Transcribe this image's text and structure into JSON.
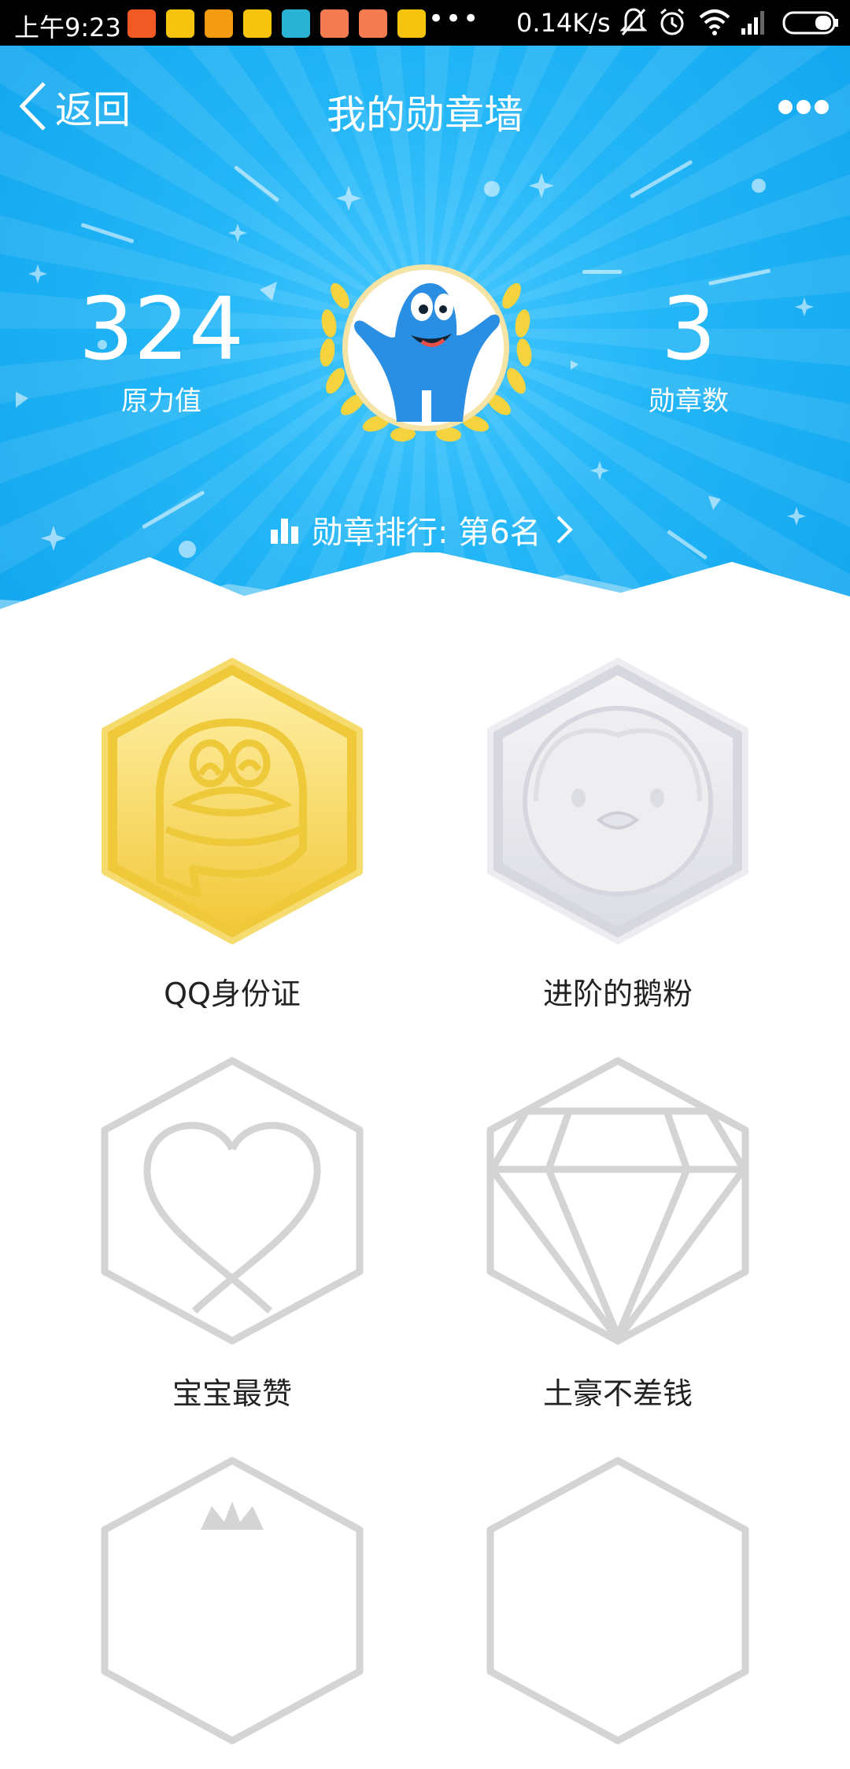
{
  "status_bar": {
    "time": "上午9:23",
    "more_indicator": "•••",
    "network_speed": "0.14K/s",
    "notification_icons": [
      "taobao-icon",
      "weibo-icon",
      "uc-icon",
      "weibo-icon",
      "clock-app-icon",
      "mi-icon",
      "mi-icon",
      "weibo-icon"
    ],
    "system_icons": [
      "mute-icon",
      "alarm-icon",
      "wifi-icon",
      "signal-icon",
      "battery-icon"
    ]
  },
  "header": {
    "back_label": "返回",
    "title": "我的勋章墙",
    "more_icon": "more-icon"
  },
  "stats": {
    "force_value": "324",
    "force_label": "原力值",
    "medal_count": "3",
    "medal_label": "勋章数"
  },
  "rank": {
    "text": "勋章排行: 第6名"
  },
  "badges": [
    {
      "name": "QQ身份证",
      "state": "gold"
    },
    {
      "name": "进阶的鹅粉",
      "state": "silver"
    },
    {
      "name": "宝宝最赞",
      "state": "locked"
    },
    {
      "name": "土豪不差钱",
      "state": "locked"
    },
    {
      "name": "",
      "state": "locked"
    },
    {
      "name": "",
      "state": "locked"
    }
  ],
  "colors": {
    "header_blue": "#1eaff3",
    "gold": "#f5d34a",
    "silver": "#d9dbe4",
    "locked_gray": "#d4d4d4"
  }
}
